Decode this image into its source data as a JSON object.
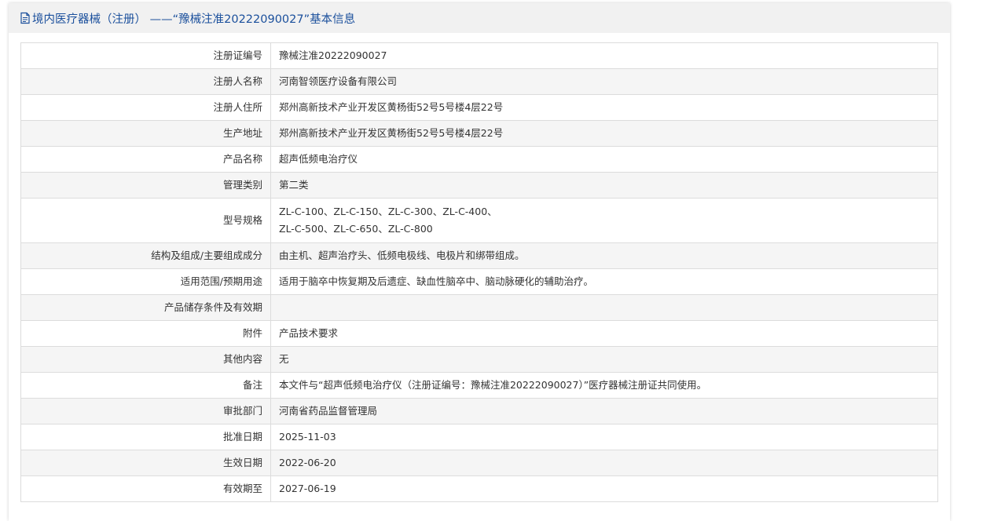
{
  "header": {
    "title": "境内医疗器械（注册） ——“豫械注准20222090027”基本信息",
    "icon": "document-icon",
    "accent_color": "#1a4f9c"
  },
  "rows": [
    {
      "label": "注册证编号",
      "value": "豫械注准20222090027"
    },
    {
      "label": "注册人名称",
      "value": "河南智领医疗设备有限公司"
    },
    {
      "label": "注册人住所",
      "value": "郑州高新技术产业开发区黄杨街52号5号楼4层22号"
    },
    {
      "label": "生产地址",
      "value": "郑州高新技术产业开发区黄杨街52号5号楼4层22号"
    },
    {
      "label": "产品名称",
      "value": "超声低频电治疗仪"
    },
    {
      "label": "管理类别",
      "value": "第二类"
    },
    {
      "label": "型号规格",
      "value": "ZL-C-100、ZL-C-150、ZL-C-300、ZL-C-400、",
      "value2": "ZL-C-500、ZL-C-650、ZL-C-800"
    },
    {
      "label": "结构及组成/主要组成成分",
      "value": "由主机、超声治疗头、低频电极线、电极片和绑带组成。"
    },
    {
      "label": "适用范围/预期用途",
      "value": "适用于脑卒中恢复期及后遗症、缺血性脑卒中、脑动脉硬化的辅助治疗。"
    },
    {
      "label": "产品储存条件及有效期",
      "value": ""
    },
    {
      "label": "附件",
      "value": "产品技术要求"
    },
    {
      "label": "其他内容",
      "value": "无"
    },
    {
      "label": "备注",
      "value": "本文件与“超声低频电治疗仪（注册证编号：豫械注准20222090027）”医疗器械注册证共同使用。"
    },
    {
      "label": "审批部门",
      "value": "河南省药品监督管理局"
    },
    {
      "label": "批准日期",
      "value": "2025-11-03"
    },
    {
      "label": "生效日期",
      "value": "2022-06-20"
    },
    {
      "label": "有效期至",
      "value": "2027-06-19"
    }
  ]
}
